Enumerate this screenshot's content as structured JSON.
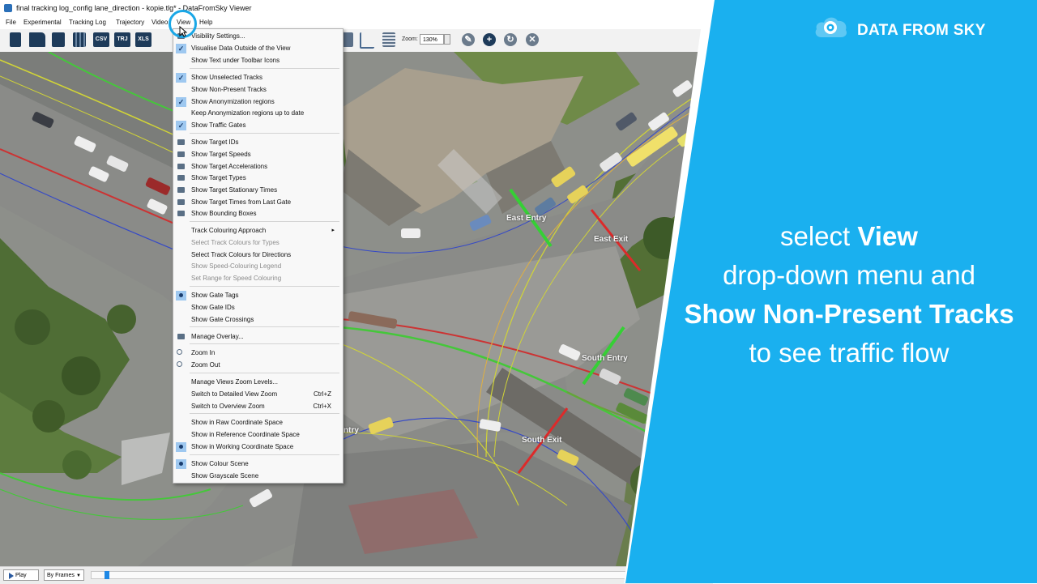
{
  "window": {
    "title": "final tracking log_config lane_direction - kopie.tlg* - DataFromSky Viewer"
  },
  "menubar": {
    "items": [
      "File",
      "Experimental",
      "Tracking Log",
      "Trajectory",
      "Video",
      "View",
      "Help"
    ]
  },
  "toolbar": {
    "csv": "CSV",
    "trj": "TRJ",
    "xls": "XLS",
    "zoom_label": "Zoom:",
    "zoom_value": "130%"
  },
  "map_labels": {
    "east_entry": "East Entry",
    "east_exit": "East Exit",
    "south_entry": "South Entry",
    "south_exit": "South Exit",
    "west_partial": "ntry"
  },
  "view_menu": {
    "items": [
      {
        "label": "Visibility Settings...",
        "mark": "icon"
      },
      {
        "label": "Visualise Data Outside of the View",
        "mark": "check"
      },
      {
        "label": "Show Text under Toolbar Icons",
        "mark": ""
      },
      {
        "label": "Show Unselected Tracks",
        "mark": "check"
      },
      {
        "label": "Show Non-Present Tracks",
        "mark": ""
      },
      {
        "label": "Show Anonymization regions",
        "mark": "check"
      },
      {
        "label": "Keep Anonymization regions up to date",
        "mark": ""
      },
      {
        "label": "Show Traffic Gates",
        "mark": "check"
      },
      {
        "label": "Show Target IDs",
        "mark": "icon"
      },
      {
        "label": "Show Target Speeds",
        "mark": "icon"
      },
      {
        "label": "Show Target Accelerations",
        "mark": "icon"
      },
      {
        "label": "Show Target Types",
        "mark": "icon"
      },
      {
        "label": "Show Target Stationary Times",
        "mark": "icon"
      },
      {
        "label": "Show Target Times from Last Gate",
        "mark": "icon"
      },
      {
        "label": "Show Bounding Boxes",
        "mark": "icon"
      },
      {
        "label": "Track Colouring Approach",
        "mark": "",
        "submenu": "▸"
      },
      {
        "label": "Select Track Colours for Types",
        "mark": "",
        "disabled": true
      },
      {
        "label": "Select Track Colours for Directions",
        "mark": ""
      },
      {
        "label": "Show Speed-Colouring Legend",
        "mark": "",
        "disabled": true
      },
      {
        "label": "Set Range for Speed Colouring",
        "mark": "",
        "disabled": true
      },
      {
        "label": "Show Gate Tags",
        "mark": "radio"
      },
      {
        "label": "Show Gate IDs",
        "mark": ""
      },
      {
        "label": "Show Gate Crossings",
        "mark": ""
      },
      {
        "label": "Manage Overlay...",
        "mark": "icon"
      },
      {
        "label": "Zoom In",
        "mark": "mag"
      },
      {
        "label": "Zoom Out",
        "mark": "mag"
      },
      {
        "label": "Manage Views Zoom Levels...",
        "mark": ""
      },
      {
        "label": "Switch to Detailed View Zoom",
        "mark": "",
        "shortcut": "Ctrl+Z"
      },
      {
        "label": "Switch to Overview Zoom",
        "mark": "",
        "shortcut": "Ctrl+X"
      },
      {
        "label": "Show in Raw Coordinate Space",
        "mark": ""
      },
      {
        "label": "Show in Reference Coordinate Space",
        "mark": ""
      },
      {
        "label": "Show in Working Coordinate Space",
        "mark": "radio"
      },
      {
        "label": "Show Colour Scene",
        "mark": "radio"
      },
      {
        "label": "Show Grayscale Scene",
        "mark": ""
      }
    ]
  },
  "playback": {
    "play": "Play",
    "mode": "By Frames",
    "position": 0.01
  },
  "brand": {
    "name": "DATA FROM SKY"
  },
  "caption": {
    "l1_pre": "select ",
    "l1_bold": "View",
    "l2": "drop-down menu and",
    "l3_bold": "Show Non-Present Tracks",
    "l4": "to see traffic flow"
  },
  "colors": {
    "accent": "#1ab0ef",
    "menu_check_bg": "#9ec8f0",
    "toolbar_dark": "#1e3b5a"
  }
}
